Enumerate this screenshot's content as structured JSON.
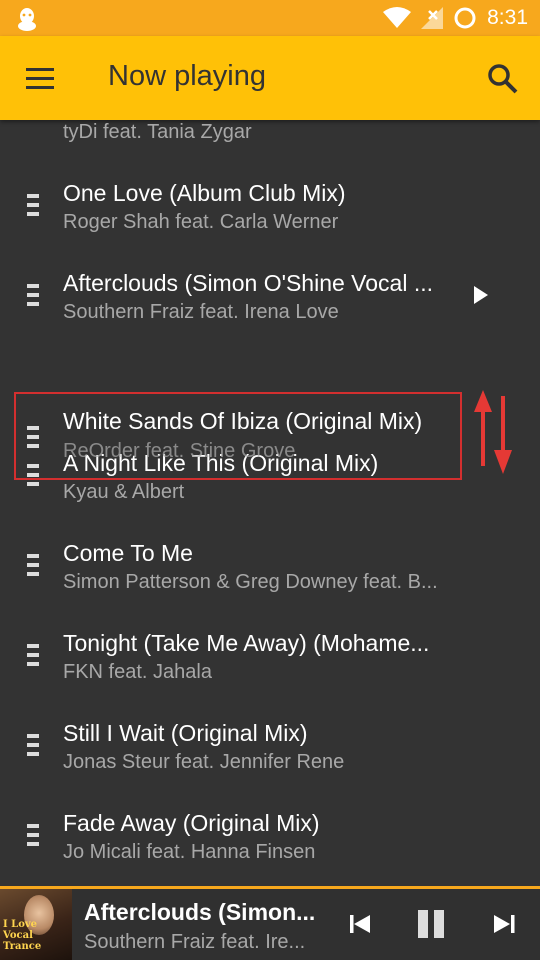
{
  "status_bar": {
    "time": "8:31"
  },
  "app_bar": {
    "title": "Now playing"
  },
  "queue": [
    {
      "title": "",
      "artist": "tyDi feat. Tania Zygar"
    },
    {
      "title": "One Love (Album Club Mix)",
      "artist": "Roger Shah feat. Carla Werner"
    },
    {
      "title": "Afterclouds (Simon O'Shine Vocal ...",
      "artist": "Southern Fraiz feat. Irena Love",
      "playing": true
    },
    {
      "title": "A Night Like This (Original Mix)",
      "artist": "Kyau & Albert"
    },
    {
      "title": "Come To Me",
      "artist": "Simon Patterson & Greg Downey feat. B..."
    },
    {
      "title": "Tonight (Take Me Away) (Mohame...",
      "artist": "FKN feat. Jahala"
    },
    {
      "title": "Still I Wait (Original Mix)",
      "artist": "Jonas Steur feat. Jennifer Rene"
    },
    {
      "title": "Fade Away (Original Mix)",
      "artist": "Jo Micali feat. Hanna Finsen"
    }
  ],
  "dragging": {
    "title": "White Sands Of Ibiza (Original Mix)",
    "artist": "ReOrder feat. Stine Grove"
  },
  "mini_player": {
    "title": "Afterclouds (Simon...",
    "artist": "Southern Fraiz feat. Ire...",
    "album_text": [
      "I Love",
      "Vocal",
      "Trance"
    ]
  },
  "colors": {
    "status": "#f7a81d",
    "app_bar": "#ffc107",
    "background": "#333333",
    "drag_outline": "#d32f2f"
  }
}
